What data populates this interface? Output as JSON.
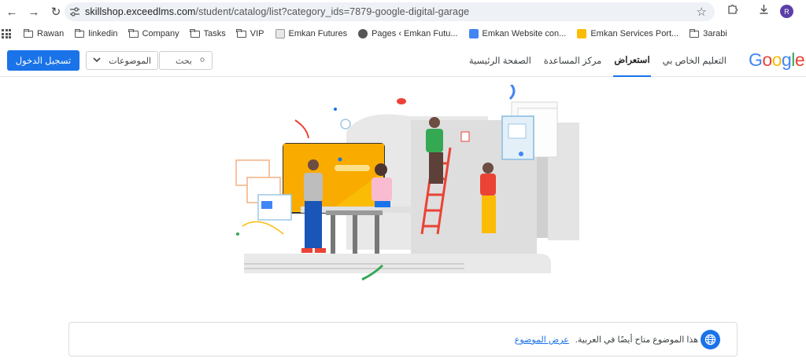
{
  "browser": {
    "url_host": "skillshop.exceedlms.com",
    "url_path": "/student/catalog/list?category_ids=7879-google-digital-garage",
    "profile_initial": "R",
    "bookmarks": [
      {
        "label": "Rawan",
        "icon": "folder-icon"
      },
      {
        "label": "linkedin",
        "icon": "folder-icon"
      },
      {
        "label": "Company",
        "icon": "folder-icon"
      },
      {
        "label": "Tasks",
        "icon": "folder-icon"
      },
      {
        "label": "VIP",
        "icon": "folder-icon"
      },
      {
        "label": "Emkan Futures",
        "icon": "site-icon"
      },
      {
        "label": "Pages ‹ Emkan Futu...",
        "icon": "globe-icon"
      },
      {
        "label": "Emkan Website con...",
        "icon": "docs-icon"
      },
      {
        "label": "Emkan Services Port...",
        "icon": "slides-icon"
      },
      {
        "label": "3arabi",
        "icon": "folder-icon"
      }
    ]
  },
  "header": {
    "login_label": "تسجيل الدخول",
    "topics_label": "الموضوعات",
    "search_placeholder": "بحث",
    "logo_text": "Google",
    "nav": [
      {
        "label": "الصفحة الرئيسية",
        "active": false
      },
      {
        "label": "مركز المساعدة",
        "active": false
      },
      {
        "label": "استعراض",
        "active": true
      },
      {
        "label": "التعليم الخاص بي",
        "active": false
      }
    ]
  },
  "banner": {
    "text": "هذا الموضوع متاح أيضًا في العربية.",
    "link": "عرض الموضوع"
  },
  "colors": {
    "accent": "#1a73e8",
    "google_blue": "#4285f4",
    "google_red": "#ea4335",
    "google_yellow": "#fbbc05",
    "google_green": "#34a853"
  }
}
